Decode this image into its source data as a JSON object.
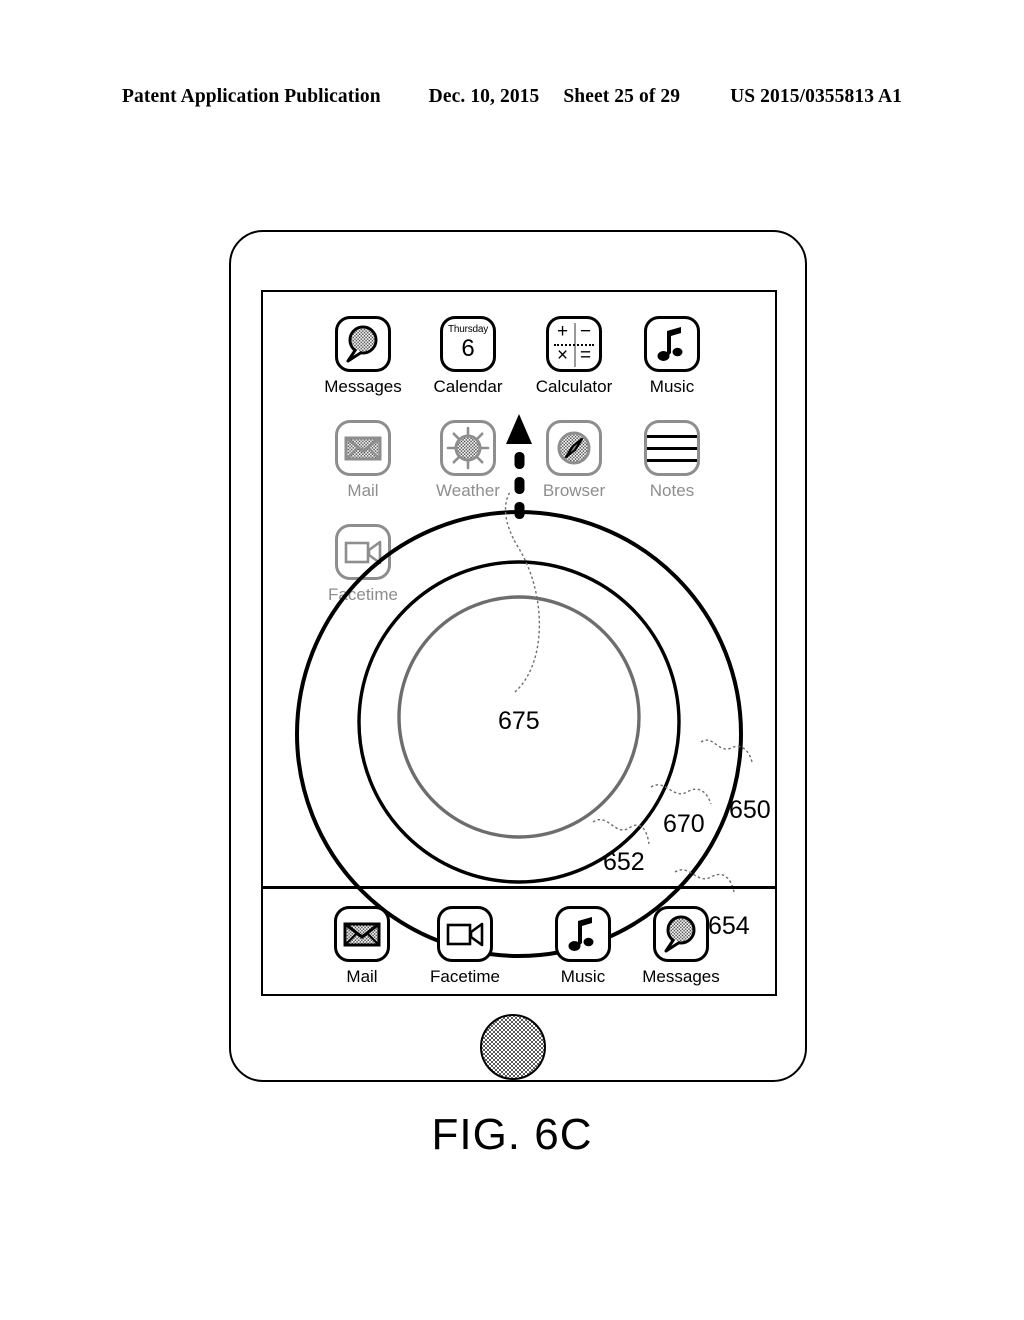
{
  "header": {
    "publication": "Patent Application Publication",
    "date": "Dec. 10, 2015",
    "sheet": "Sheet 25 of 29",
    "pub_number": "US 2015/0355813 A1"
  },
  "figure": {
    "caption": "FIG. 6C"
  },
  "device": {
    "home_button_name": "home-button"
  },
  "home_screen": {
    "rows": [
      [
        {
          "label": "Messages",
          "icon": "messages-icon"
        },
        {
          "label": "Calendar",
          "icon": "calendar-icon",
          "day": "Thursday",
          "date": "6"
        },
        {
          "label": "Calculator",
          "icon": "calculator-icon",
          "ops": [
            "+",
            "−",
            "×",
            "="
          ]
        },
        {
          "label": "Music",
          "icon": "music-icon"
        }
      ],
      [
        {
          "label": "Mail",
          "icon": "mail-icon"
        },
        {
          "label": "Weather",
          "icon": "weather-icon"
        },
        {
          "label": "Browser",
          "icon": "browser-icon"
        },
        {
          "label": "Notes",
          "icon": "notes-icon"
        }
      ],
      [
        {
          "label": "Facetime",
          "icon": "facetime-icon"
        }
      ]
    ]
  },
  "dock": {
    "items": [
      {
        "label": "Mail",
        "icon": "mail-icon"
      },
      {
        "label": "Facetime",
        "icon": "facetime-icon"
      },
      {
        "label": "Music",
        "icon": "music-icon"
      },
      {
        "label": "Messages",
        "icon": "messages-icon"
      }
    ]
  },
  "dial": {
    "gesture": "upward-swipe-arrow",
    "reference_numerals": {
      "inner_region": "675",
      "inner_ring": "670",
      "middle_ring": "652",
      "outer_ring": "650",
      "outer_boundary": "654"
    }
  },
  "colors": {
    "ink": "#000000",
    "faded_ink": "#8e8e8e",
    "ring_gray": "#6d6d6d",
    "paper": "#ffffff"
  }
}
